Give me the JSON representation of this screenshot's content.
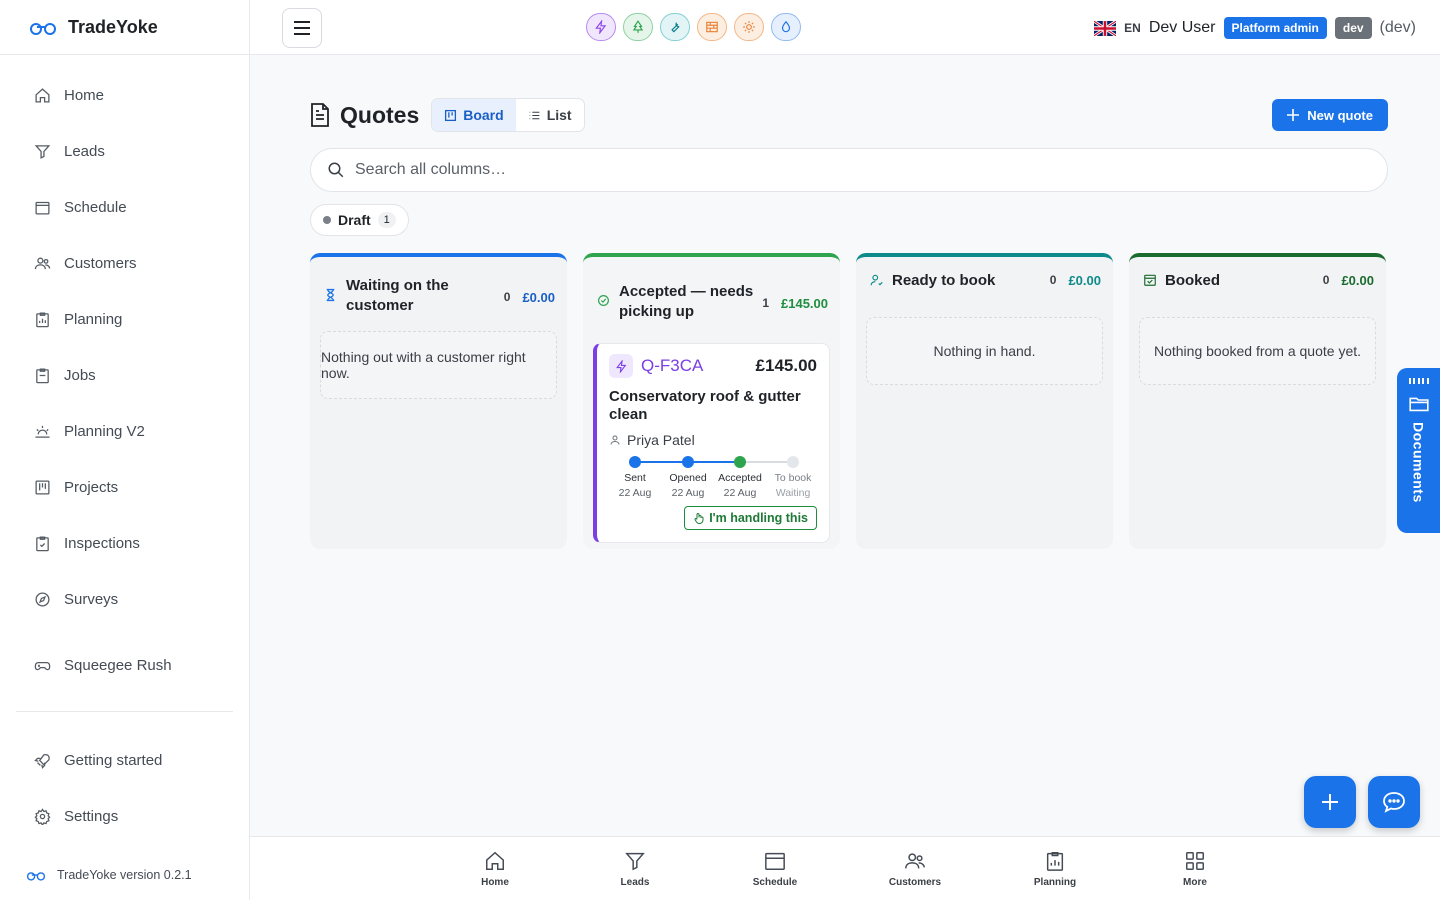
{
  "brand": {
    "name": "TradeYoke",
    "version": "TradeYoke version 0.2.1"
  },
  "sidebar": {
    "items": [
      {
        "label": "Home",
        "icon": "home-icon"
      },
      {
        "label": "Leads",
        "icon": "filter-icon"
      },
      {
        "label": "Schedule",
        "icon": "calendar-icon"
      },
      {
        "label": "Customers",
        "icon": "users-icon"
      },
      {
        "label": "Planning",
        "icon": "clipboard-chart-icon"
      },
      {
        "label": "Jobs",
        "icon": "clipboard-icon"
      },
      {
        "label": "Planning V2",
        "icon": "sunrise-icon"
      },
      {
        "label": "Projects",
        "icon": "kanban-icon"
      },
      {
        "label": "Inspections",
        "icon": "clipboard-check-icon"
      },
      {
        "label": "Surveys",
        "icon": "compass-icon"
      },
      {
        "label": "Squeegee Rush",
        "icon": "gamepad-icon"
      }
    ],
    "footer_items": [
      {
        "label": "Getting started",
        "icon": "rocket-icon"
      },
      {
        "label": "Settings",
        "icon": "gear-icon"
      }
    ]
  },
  "header": {
    "theme_colors": [
      "#8e44e8",
      "#2ea44f",
      "#0e9aa7",
      "#e8843a",
      "#e8843a",
      "#1a73e8"
    ],
    "lang": "EN",
    "user": "Dev User",
    "role_badge": "Platform admin",
    "env_badge": "dev",
    "env_text": "(dev)"
  },
  "page": {
    "title": "Quotes",
    "view_board": "Board",
    "view_list": "List",
    "new_button": "New quote",
    "search_placeholder": "Search all columns…",
    "filter_chip": {
      "label": "Draft",
      "count": "1"
    }
  },
  "columns": [
    {
      "title": "Waiting on the customer",
      "count": "0",
      "sum": "£0.00",
      "empty": "Nothing out with a customer right now.",
      "color": "#1a73e8"
    },
    {
      "title": "Accepted — needs picking up",
      "count": "1",
      "sum": "£145.00",
      "color": "#2ea44f"
    },
    {
      "title": "Ready to book",
      "count": "0",
      "sum": "£0.00",
      "empty": "Nothing in hand.",
      "color": "#0e8a8a"
    },
    {
      "title": "Booked",
      "count": "0",
      "sum": "£0.00",
      "empty": "Nothing booked from a quote yet.",
      "color": "#1b6b2e"
    }
  ],
  "quote_card": {
    "ref": "Q-F3CA",
    "amount": "£145.00",
    "title": "Conservatory roof & gutter clean",
    "customer": "Priya Patel",
    "steps": [
      {
        "name": "Sent",
        "date": "22 Aug"
      },
      {
        "name": "Opened",
        "date": "22 Aug"
      },
      {
        "name": "Accepted",
        "date": "22 Aug"
      },
      {
        "name": "To book",
        "date": "Waiting"
      }
    ],
    "action": "I'm handling this"
  },
  "documents_tab": "Documents",
  "bottom_nav": [
    {
      "label": "Home",
      "icon": "home-icon"
    },
    {
      "label": "Leads",
      "icon": "filter-icon"
    },
    {
      "label": "Schedule",
      "icon": "calendar-icon"
    },
    {
      "label": "Customers",
      "icon": "users-icon"
    },
    {
      "label": "Planning",
      "icon": "clipboard-chart-icon"
    },
    {
      "label": "More",
      "icon": "grid-icon"
    }
  ]
}
